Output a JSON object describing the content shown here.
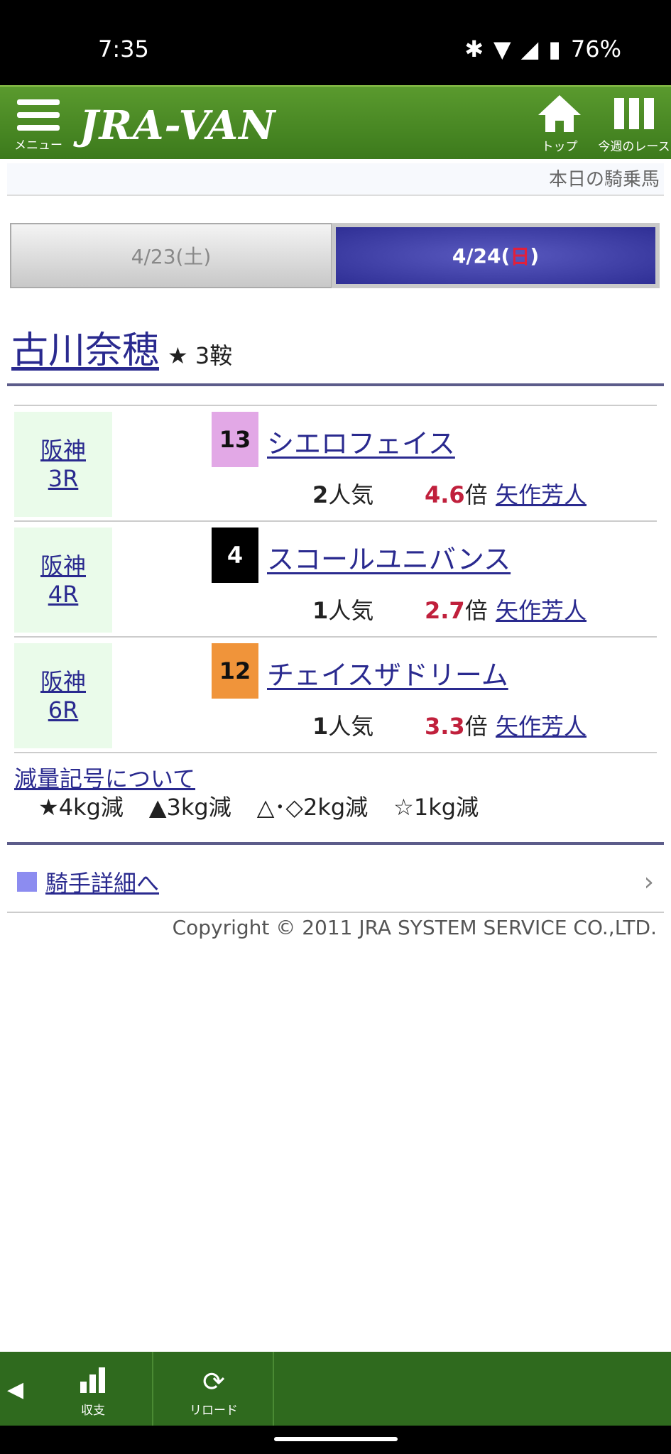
{
  "status_bar": {
    "time": "7:35",
    "battery": "76%"
  },
  "header": {
    "menu_label": "メニュー",
    "logo": "JRA-VAN",
    "top_label": "トップ",
    "week_label": "今週のレース"
  },
  "subheader": {
    "title": "本日の騎乗馬"
  },
  "tabs": [
    {
      "label": "4/23(土)",
      "selected": false
    },
    {
      "date": "4/24(",
      "day": "日",
      "close": ")",
      "selected": true
    }
  ],
  "jockey": {
    "name": "古川奈穂",
    "rides": "★ 3鞍"
  },
  "races": [
    {
      "venue": "阪神",
      "race": "3R",
      "post": "13",
      "post_color": "#e2a8e6",
      "post_text_color": "#111",
      "horse": "シエロフェイス",
      "pop_num": "2",
      "pop_suffix": "人気",
      "odds": "4.6",
      "odds_suffix": "倍",
      "trainer": "矢作芳人"
    },
    {
      "venue": "阪神",
      "race": "4R",
      "post": "4",
      "post_color": "#000000",
      "post_text_color": "#fff",
      "horse": "スコールユニバンス",
      "pop_num": "1",
      "pop_suffix": "人気",
      "odds": "2.7",
      "odds_suffix": "倍",
      "trainer": "矢作芳人"
    },
    {
      "venue": "阪神",
      "race": "6R",
      "post": "12",
      "post_color": "#f0943a",
      "post_text_color": "#111",
      "horse": "チェイスザドリーム",
      "pop_num": "1",
      "pop_suffix": "人気",
      "odds": "3.3",
      "odds_suffix": "倍",
      "trainer": "矢作芳人"
    }
  ],
  "weight_note": {
    "link": "減量記号について",
    "items": [
      "★4kg減",
      "▲3kg減",
      "△･◇2kg減",
      "☆1kg減"
    ]
  },
  "detail_link": "騎手詳細へ",
  "copyright": "Copyright © 2011 JRA SYSTEM SERVICE CO.,LTD.",
  "bottom_bar": {
    "balance_label": "収支",
    "reload_label": "リロード"
  }
}
